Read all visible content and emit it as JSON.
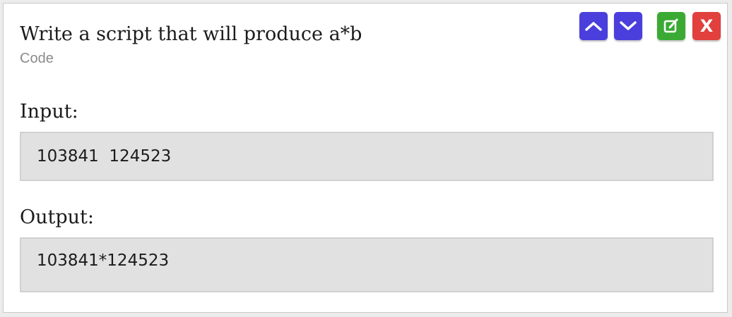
{
  "card": {
    "title": "Write a script that will produce a*b",
    "subtitle": "Code"
  },
  "toolbar": {
    "move_up_icon": "chevron-up-icon",
    "move_down_icon": "chevron-down-icon",
    "edit_icon": "edit-icon",
    "delete_label": "X"
  },
  "input": {
    "label": "Input:",
    "value": "103841  124523"
  },
  "output": {
    "label": "Output:",
    "value": "103841*124523"
  },
  "colors": {
    "move_buttons": "#4a3fdc",
    "edit_button": "#3aaa35",
    "delete_button": "#e1403c",
    "code_background": "#e1e1e1"
  }
}
